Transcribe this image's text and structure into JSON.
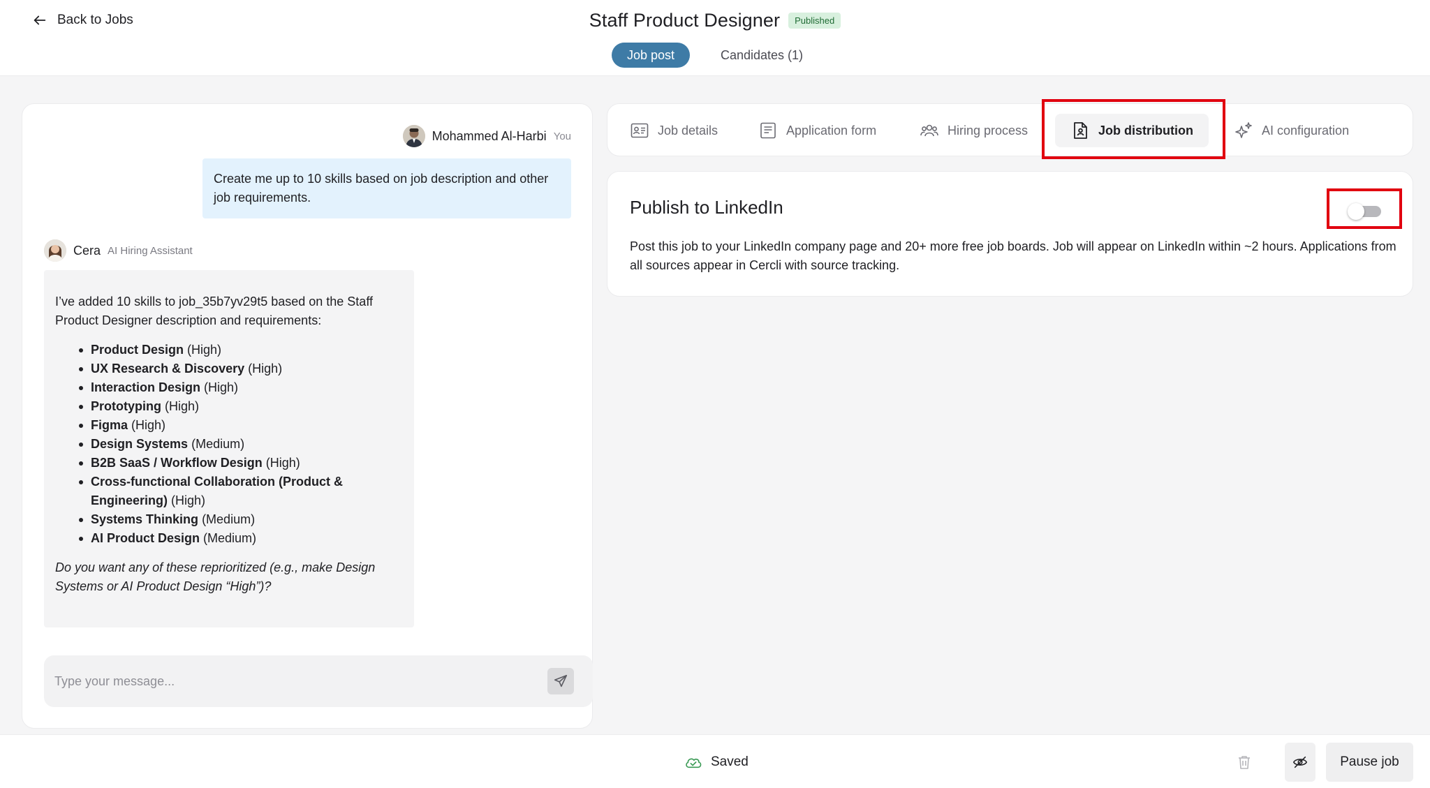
{
  "header": {
    "back_label": "Back to Jobs",
    "title": "Staff Product Designer",
    "status": "Published",
    "tabs": [
      {
        "label": "Job post",
        "active": true
      },
      {
        "label": "Candidates (1)",
        "active": false
      }
    ]
  },
  "chat": {
    "user": {
      "name": "Mohammed Al-Harbi",
      "tag": "You"
    },
    "user_message": "Create me up to 10 skills based on job description and other job requirements.",
    "assistant": {
      "name": "Cera",
      "role": "AI Hiring Assistant"
    },
    "assistant_intro": "I’ve added 10 skills to job_35b7yv29t5 based on the Staff Product Designer description and requirements:",
    "skills": [
      {
        "name": "Product Design",
        "level": "(High)"
      },
      {
        "name": "UX Research & Discovery",
        "level": "(High)"
      },
      {
        "name": "Interaction Design",
        "level": "(High)"
      },
      {
        "name": "Prototyping",
        "level": "(High)"
      },
      {
        "name": "Figma",
        "level": "(High)"
      },
      {
        "name": "Design Systems",
        "level": "(Medium)"
      },
      {
        "name": "B2B SaaS / Workflow Design",
        "level": "(High)"
      },
      {
        "name": "Cross-functional Collaboration (Product & Engineering)",
        "level": "(High)"
      },
      {
        "name": "Systems Thinking",
        "level": "(Medium)"
      },
      {
        "name": "AI Product Design",
        "level": "(Medium)"
      }
    ],
    "assistant_followup": "Do you want any of these reprioritized (e.g., make Design Systems or AI Product Design “High”)?",
    "input_placeholder": "Type your message..."
  },
  "section_tabs": [
    {
      "label": "Job details",
      "icon": "id-card-icon"
    },
    {
      "label": "Application form",
      "icon": "form-icon"
    },
    {
      "label": "Hiring process",
      "icon": "people-icon"
    },
    {
      "label": "Job distribution",
      "icon": "document-person-icon",
      "active": true
    },
    {
      "label": "AI configuration",
      "icon": "sparkles-icon"
    }
  ],
  "publish": {
    "title": "Publish to LinkedIn",
    "description": "Post this job to your LinkedIn company page and 20+ more free job boards. Job will appear on LinkedIn within ~2 hours. Applications from all sources appear in Cercli with source tracking.",
    "enabled": false
  },
  "footer": {
    "saved_label": "Saved",
    "pause_label": "Pause job"
  },
  "colors": {
    "accent": "#3e7ba6",
    "highlight": "#e1000f",
    "user_bubble": "#e3f2fd",
    "saved_green": "#3a9a55"
  }
}
